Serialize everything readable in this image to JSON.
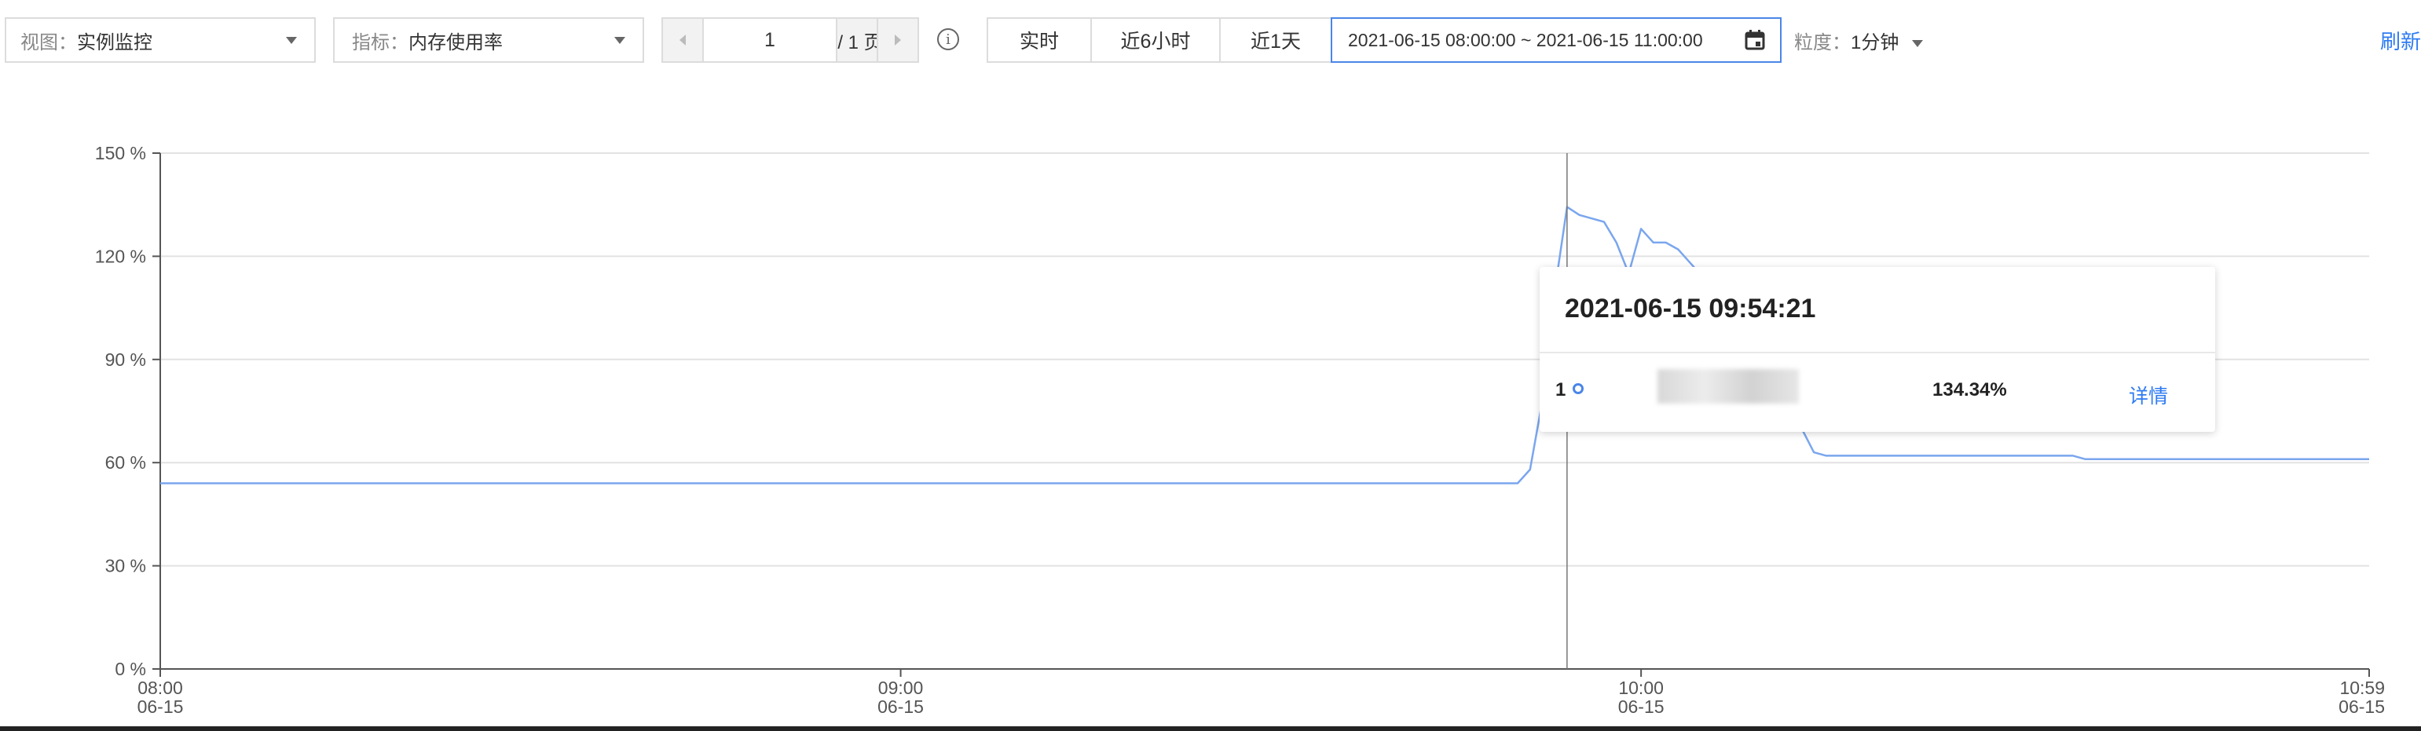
{
  "toolbar": {
    "view_select": {
      "label": "视图：",
      "value": "实例监控"
    },
    "metric_select": {
      "label": "指标：",
      "value": "内存使用率"
    },
    "pager": {
      "page": "1",
      "total": "/ 1 页"
    },
    "info_icon": "info-icon",
    "range_buttons": [
      "实时",
      "近6小时",
      "近1天"
    ],
    "date_range": "2021-06-15 08:00:00 ~ 2021-06-15 11:00:00",
    "calendar_icon": "calendar-icon",
    "granularity": {
      "label": "粒度：",
      "value": "1分钟"
    },
    "refresh": "刷新"
  },
  "tooltip": {
    "title": "2021-06-15 09:54:21",
    "index": "1",
    "value": "134.34%",
    "link": "详情"
  },
  "chart_data": {
    "type": "line",
    "series": [
      {
        "color": "#7aa6ee",
        "x": [
          "08:00",
          "08:30",
          "09:00",
          "09:30",
          "09:50",
          "09:51",
          "09:52",
          "09:53",
          "09:54",
          "09:55",
          "09:56",
          "09:57",
          "09:58",
          "09:59",
          "10:00",
          "10:01",
          "10:02",
          "10:03",
          "10:04",
          "10:05",
          "10:06",
          "10:07",
          "10:08",
          "10:09",
          "10:10",
          "10:13",
          "10:14",
          "10:15",
          "10:20",
          "10:30",
          "10:35",
          "10:36",
          "10:45",
          "10:59"
        ],
        "values": [
          54,
          54,
          54,
          54,
          54,
          58,
          78,
          110,
          134.34,
          132,
          131,
          130,
          124,
          115,
          128,
          124,
          124,
          122,
          118,
          114,
          110,
          105,
          100,
          95,
          90,
          70,
          63,
          62,
          62,
          62,
          62,
          61,
          61,
          61
        ]
      }
    ],
    "x_ticks": [
      {
        "x": "08:00",
        "time": "08:00",
        "date": "06-15"
      },
      {
        "x": "09:00",
        "time": "09:00",
        "date": "06-15"
      },
      {
        "x": "10:00",
        "time": "10:00",
        "date": "06-15"
      },
      {
        "x": "10:59",
        "time": "10:59",
        "date": "06-15"
      }
    ],
    "y_ticks": [
      0,
      30,
      60,
      90,
      120,
      150
    ],
    "y_unit": "%",
    "ylim": [
      0,
      150
    ],
    "xlim": [
      "08:00",
      "10:59"
    ],
    "crosshair_x": "09:54",
    "grid": true,
    "legend": "none"
  }
}
